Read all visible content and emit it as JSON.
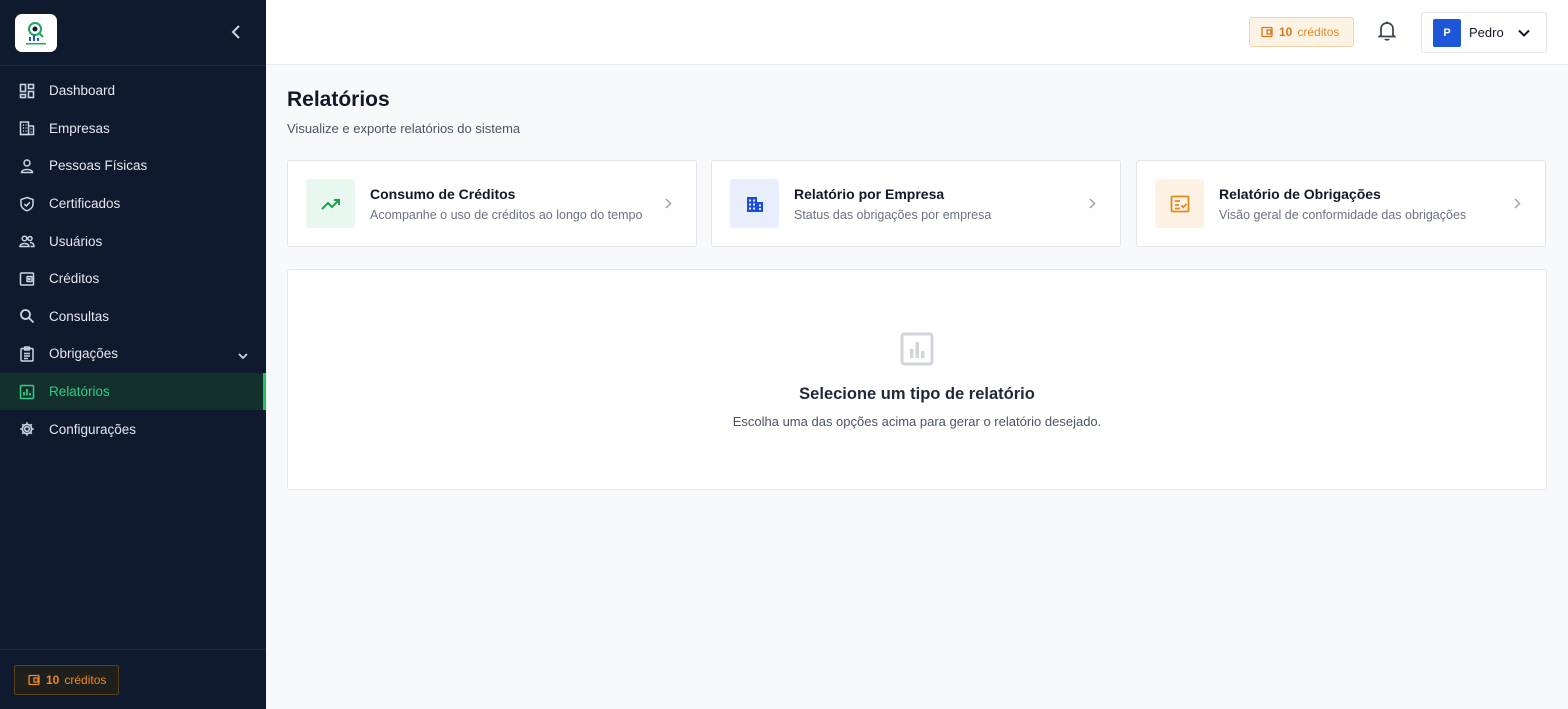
{
  "sidebar": {
    "logo_icon": "company-logo",
    "collapse_icon": "chevron-left-icon",
    "items": [
      {
        "label": "Dashboard",
        "icon": "dashboard-icon"
      },
      {
        "label": "Empresas",
        "icon": "building-icon"
      },
      {
        "label": "Pessoas Físicas",
        "icon": "person-icon"
      },
      {
        "label": "Certificados",
        "icon": "shield-check-icon"
      },
      {
        "label": "Usuários",
        "icon": "users-icon"
      },
      {
        "label": "Créditos",
        "icon": "wallet-icon"
      },
      {
        "label": "Consultas",
        "icon": "search-icon"
      },
      {
        "label": "Obrigações",
        "icon": "clipboard-icon",
        "expandable": true
      },
      {
        "label": "Relatórios",
        "icon": "report-chart-icon",
        "active": true
      },
      {
        "label": "Configurações",
        "icon": "gear-icon"
      }
    ],
    "credits": {
      "count": "10",
      "label": "créditos"
    }
  },
  "header": {
    "credits": {
      "count": "10",
      "label": "créditos"
    },
    "notification_icon": "bell-icon",
    "user": {
      "initial": "P",
      "name": "Pedro"
    }
  },
  "page": {
    "title": "Relatórios",
    "subtitle": "Visualize e exporte relatórios do sistema"
  },
  "cards": [
    {
      "title": "Consumo de Créditos",
      "description": "Acompanhe o uso de créditos ao longo do tempo",
      "icon": "trending-up-icon",
      "color": "#16a34a",
      "bg": "#e8f7ef"
    },
    {
      "title": "Relatório por Empresa",
      "description": "Status das obrigações por empresa",
      "icon": "building-icon",
      "color": "#1d4ed8",
      "bg": "#e8eefb"
    },
    {
      "title": "Relatório de Obrigações",
      "description": "Visão geral de conformidade das obrigações",
      "icon": "checklist-icon",
      "color": "#e08a1e",
      "bg": "#fdf2e4"
    }
  ],
  "empty_state": {
    "icon": "report-chart-icon",
    "title": "Selecione um tipo de relatório",
    "description": "Escolha uma das opções acima para gerar o relatório desejado."
  },
  "colors": {
    "sidebar_bg": "#0f1a2e",
    "accent_green": "#22c55e",
    "credits_orange": "#e38c2b",
    "avatar_blue": "#1e56d8"
  }
}
